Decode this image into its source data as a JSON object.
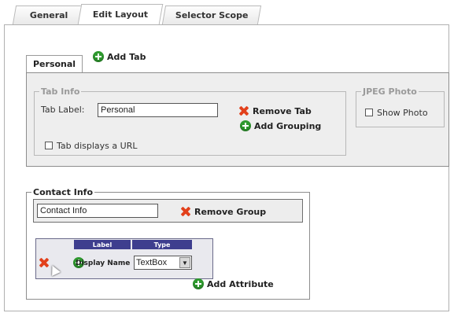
{
  "top_tabs": [
    "General",
    "Edit Layout",
    "Selector Scope"
  ],
  "inner_tabs": {
    "personal": "Personal",
    "add_tab": "Add Tab"
  },
  "tab_info": {
    "legend": "Tab Info",
    "label_caption": "Tab Label:",
    "label_value": "Personal",
    "remove_tab": "Remove Tab",
    "add_grouping": "Add Grouping",
    "displays_url": "Tab displays a URL"
  },
  "jpeg_photo": {
    "legend": "JPEG Photo",
    "show_photo": "Show Photo"
  },
  "contact_info": {
    "legend": "Contact Info",
    "group_name": "Contact Info",
    "remove_group": "Remove Group",
    "grid": {
      "col_label": "Label",
      "col_type": "Type",
      "row_label": "Display Name",
      "row_type": "TextBox"
    },
    "add_attribute": "Add Attribute"
  },
  "colors": {
    "remove_icon": "#e2401b",
    "add_icon": "#2f9a2f",
    "grid_header": "#3e3e8e"
  }
}
